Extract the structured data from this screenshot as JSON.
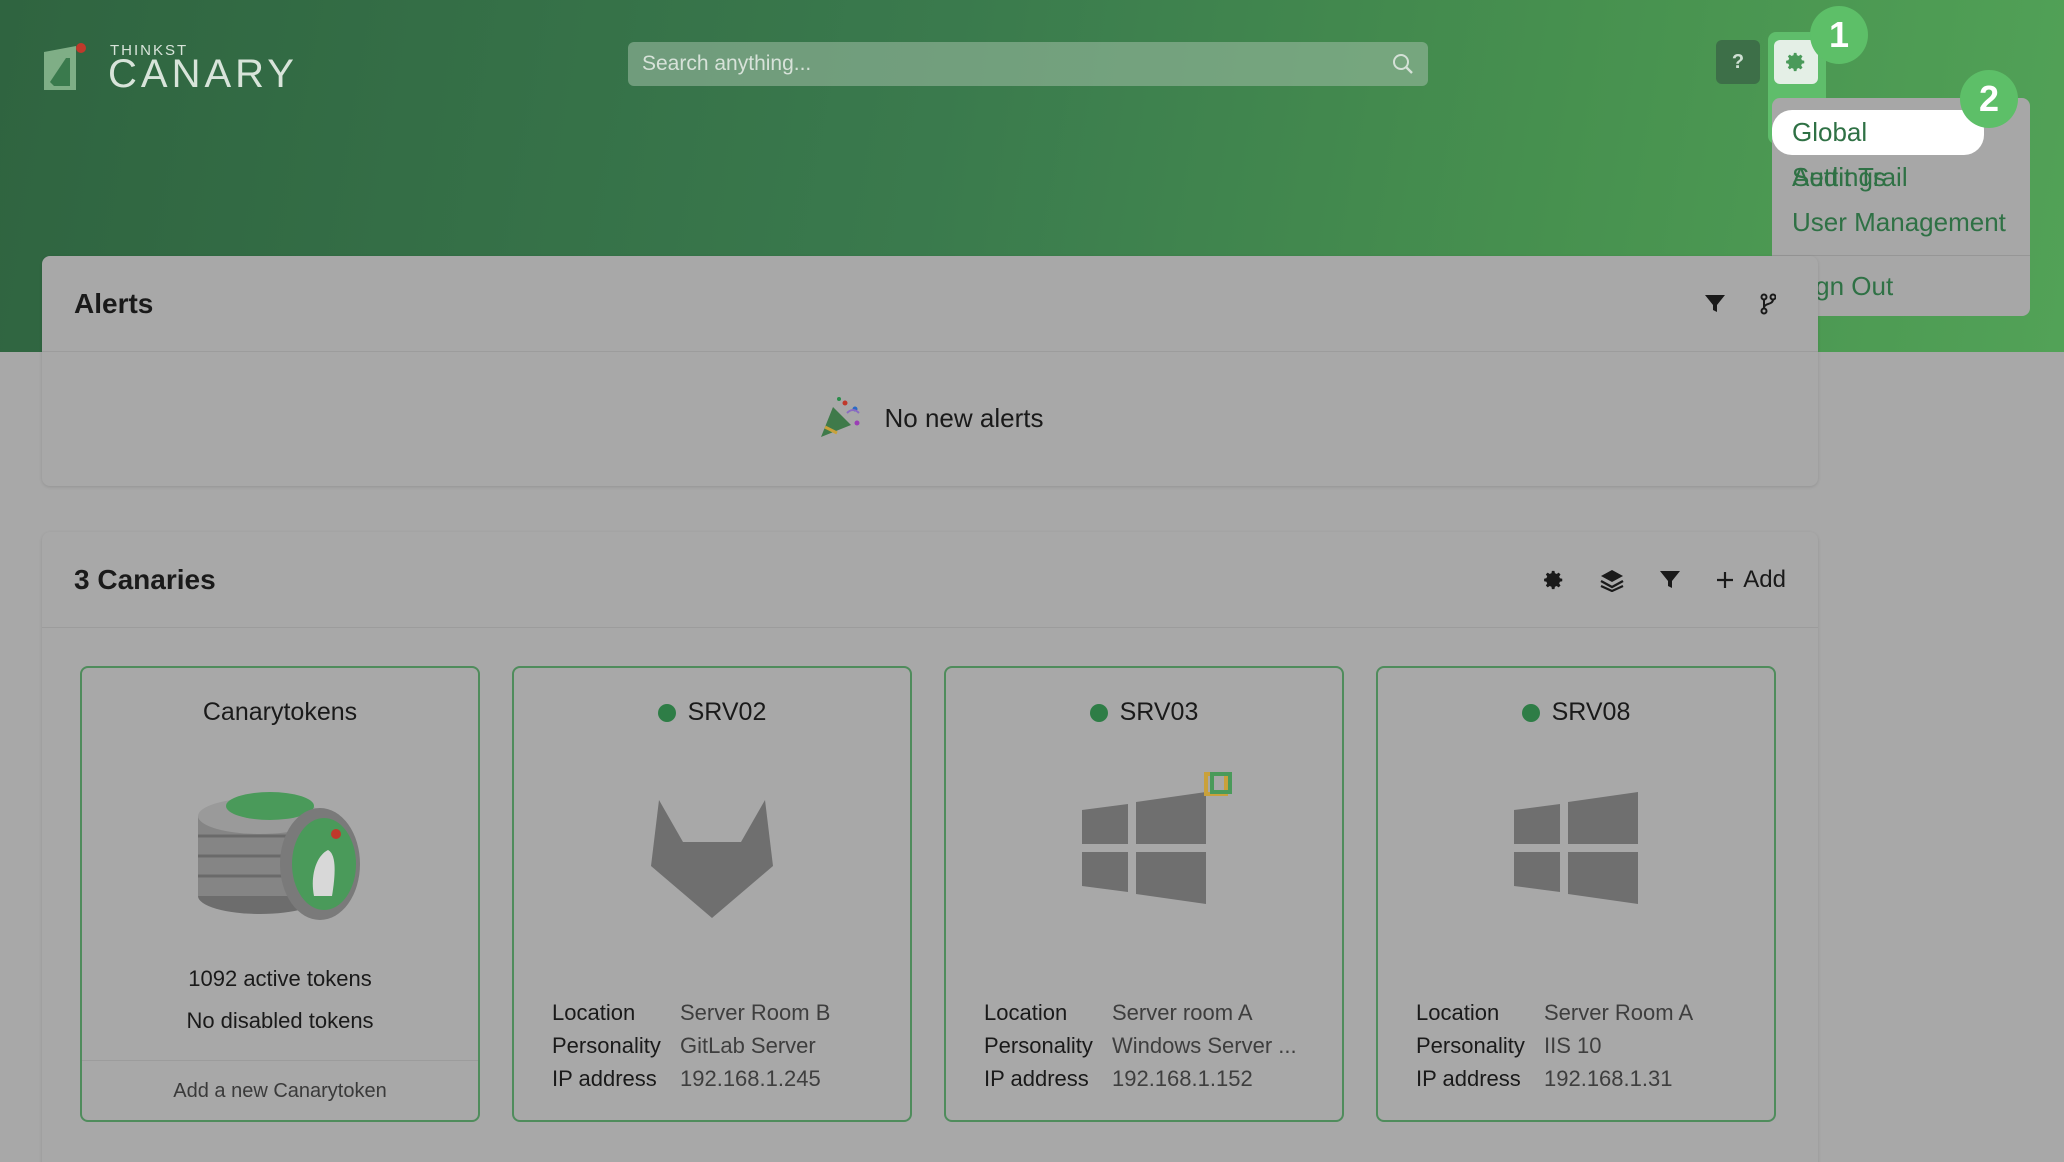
{
  "brand": {
    "small": "THINKST",
    "big": "CANARY"
  },
  "search": {
    "placeholder": "Search anything..."
  },
  "header": {
    "help_label": "?"
  },
  "badges": {
    "step1": "1",
    "step2": "2"
  },
  "settings_menu": {
    "items": [
      "Global Settings",
      "Audit Trail",
      "User Management"
    ],
    "signout": "Sign Out"
  },
  "alerts": {
    "title": "Alerts",
    "empty_text": "No new alerts"
  },
  "canaries": {
    "title": "3 Canaries",
    "add_label": "Add",
    "tokens_card": {
      "title": "Canarytokens",
      "active": "1092 active tokens",
      "disabled": "No disabled tokens",
      "footer": "Add a new Canarytoken"
    },
    "detail_labels": {
      "location": "Location",
      "personality": "Personality",
      "ip": "IP address"
    },
    "devices": [
      {
        "name": "SRV02",
        "location": "Server Room B",
        "personality": "GitLab Server",
        "ip": "192.168.1.245",
        "icon": "gitlab-icon"
      },
      {
        "name": "SRV03",
        "location": "Server room A",
        "personality": "Windows Server ...",
        "ip": "192.168.1.152",
        "icon": "windows-icon"
      },
      {
        "name": "SRV08",
        "location": "Server Room A",
        "personality": "IIS 10",
        "ip": "192.168.1.31",
        "icon": "windows-icon"
      }
    ]
  },
  "colors": {
    "brand_green": "#2f7145",
    "highlight_green": "#5dbf68",
    "status_online": "#2e7d46"
  }
}
